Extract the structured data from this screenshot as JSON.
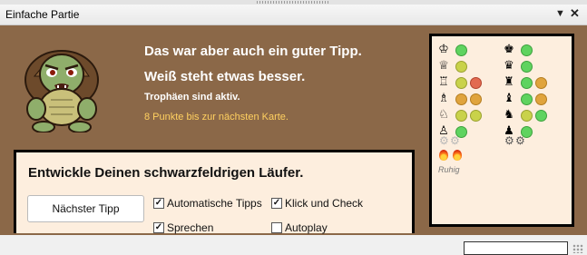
{
  "window": {
    "title": "Einfache Partie"
  },
  "coach": {
    "line1": "Das war aber auch ein guter Tipp.",
    "line2": "Weiß steht etwas besser.",
    "line3": "Trophäen sind aktiv.",
    "line4": "8 Punkte bis zur nächsten Karte."
  },
  "tip": {
    "text": "Entwickle Deinen schwarzfeldrigen Läufer.",
    "next_label": "Nächster Tipp",
    "options": [
      {
        "label": "Automatische Tipps",
        "checked": true
      },
      {
        "label": "Klick und Check",
        "checked": true
      },
      {
        "label": "Sprechen",
        "checked": true
      },
      {
        "label": "Autoplay",
        "checked": false
      }
    ]
  },
  "score": {
    "white": [
      {
        "piece": "♔",
        "dots": [
          "green"
        ]
      },
      {
        "piece": "♕",
        "dots": [
          "yellow"
        ]
      },
      {
        "piece": "♖",
        "dots": [
          "yellow",
          "red"
        ]
      },
      {
        "piece": "♗",
        "dots": [
          "orange",
          "orange"
        ]
      },
      {
        "piece": "♘",
        "dots": [
          "yellow",
          "yellow"
        ]
      },
      {
        "piece": "♙",
        "dots": [
          "green"
        ]
      }
    ],
    "black": [
      {
        "piece": "♚",
        "dots": [
          "green"
        ]
      },
      {
        "piece": "♛",
        "dots": [
          "green"
        ]
      },
      {
        "piece": "♜",
        "dots": [
          "green",
          "orange"
        ]
      },
      {
        "piece": "♝",
        "dots": [
          "green",
          "orange"
        ]
      },
      {
        "piece": "♞",
        "dots": [
          "yellow",
          "green"
        ]
      },
      {
        "piece": "♟",
        "dots": [
          "green"
        ]
      }
    ],
    "mood": "Ruhig"
  }
}
